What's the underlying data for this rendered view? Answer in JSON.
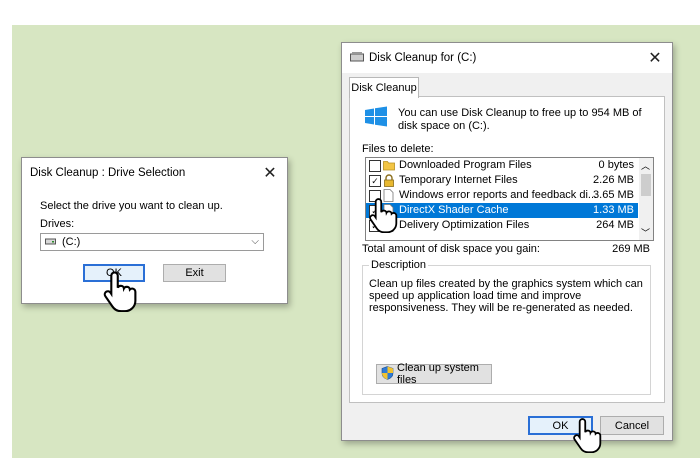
{
  "drive_selection": {
    "title": "Disk Cleanup : Drive Selection",
    "prompt": "Select the drive you want to clean up.",
    "drives_label": "Drives:",
    "drive_value": "(C:)",
    "ok_label": "OK",
    "exit_label": "Exit"
  },
  "cleanup": {
    "title": "Disk Cleanup for  (C:)",
    "tab_label": "Disk Cleanup",
    "info": "You can use Disk Cleanup to free up to 954 MB of disk space on  (C:).",
    "files_label": "Files to delete:",
    "files": [
      {
        "name": "Downloaded Program Files",
        "size": "0 bytes",
        "checked": false,
        "selected": false,
        "icon": "folder-icon"
      },
      {
        "name": "Temporary Internet Files",
        "size": "2.26 MB",
        "checked": true,
        "selected": false,
        "icon": "lock-icon"
      },
      {
        "name": "Windows error reports and feedback di...",
        "size": "3.65 MB",
        "checked": false,
        "selected": false,
        "icon": "file-icon"
      },
      {
        "name": "DirectX Shader Cache",
        "size": "1.33 MB",
        "checked": true,
        "selected": true,
        "icon": "file-icon"
      },
      {
        "name": "Delivery Optimization Files",
        "size": "264 MB",
        "checked": true,
        "selected": false,
        "icon": "file-icon"
      }
    ],
    "total_label": "Total amount of disk space you gain:",
    "total_value": "269 MB",
    "description_label": "Description",
    "description_text": "Clean up files created by the graphics system which can speed up application load time and improve responsiveness. They will be re-generated as needed.",
    "system_button": "Clean up system files",
    "ok_label": "OK",
    "cancel_label": "Cancel"
  },
  "colors": {
    "background": "#d7e6c2",
    "selection": "#0078d7",
    "default_button_border": "#2a6fd6"
  }
}
